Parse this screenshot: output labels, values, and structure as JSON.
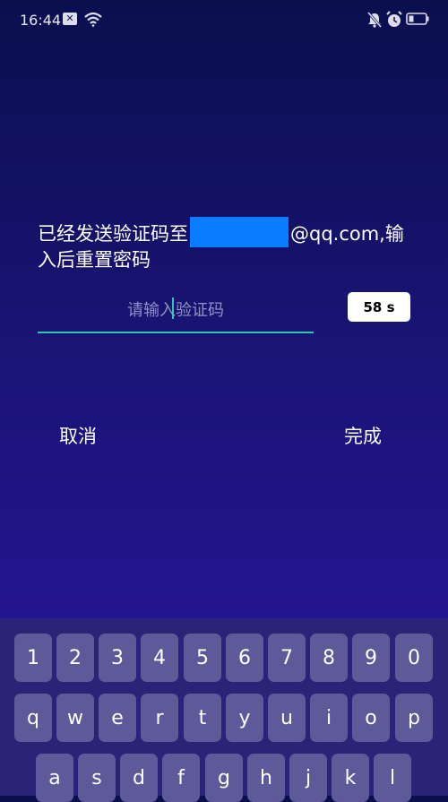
{
  "status_bar": {
    "time": "16:44",
    "icons": [
      "notification-icon",
      "wifi-icon",
      "mute-icon",
      "alarm-icon",
      "battery-icon"
    ]
  },
  "dialog": {
    "message_prefix": "已经发送验证码至",
    "message_suffix": "@qq.com,输入后重置密码",
    "code_placeholder": "请输入验证码",
    "timer_label": "58 s",
    "cancel_label": "取消",
    "done_label": "完成"
  },
  "keyboard": {
    "row1": [
      "1",
      "2",
      "3",
      "4",
      "5",
      "6",
      "7",
      "8",
      "9",
      "0"
    ],
    "row2": [
      "q",
      "w",
      "e",
      "r",
      "t",
      "y",
      "u",
      "i",
      "o",
      "p"
    ],
    "row3": [
      "a",
      "s",
      "d",
      "f",
      "g",
      "h",
      "j",
      "k",
      "l"
    ]
  },
  "colors": {
    "accent_underline": "#2ec7b4",
    "redaction": "#0a7cff",
    "key_background": "#5e5a9a"
  }
}
